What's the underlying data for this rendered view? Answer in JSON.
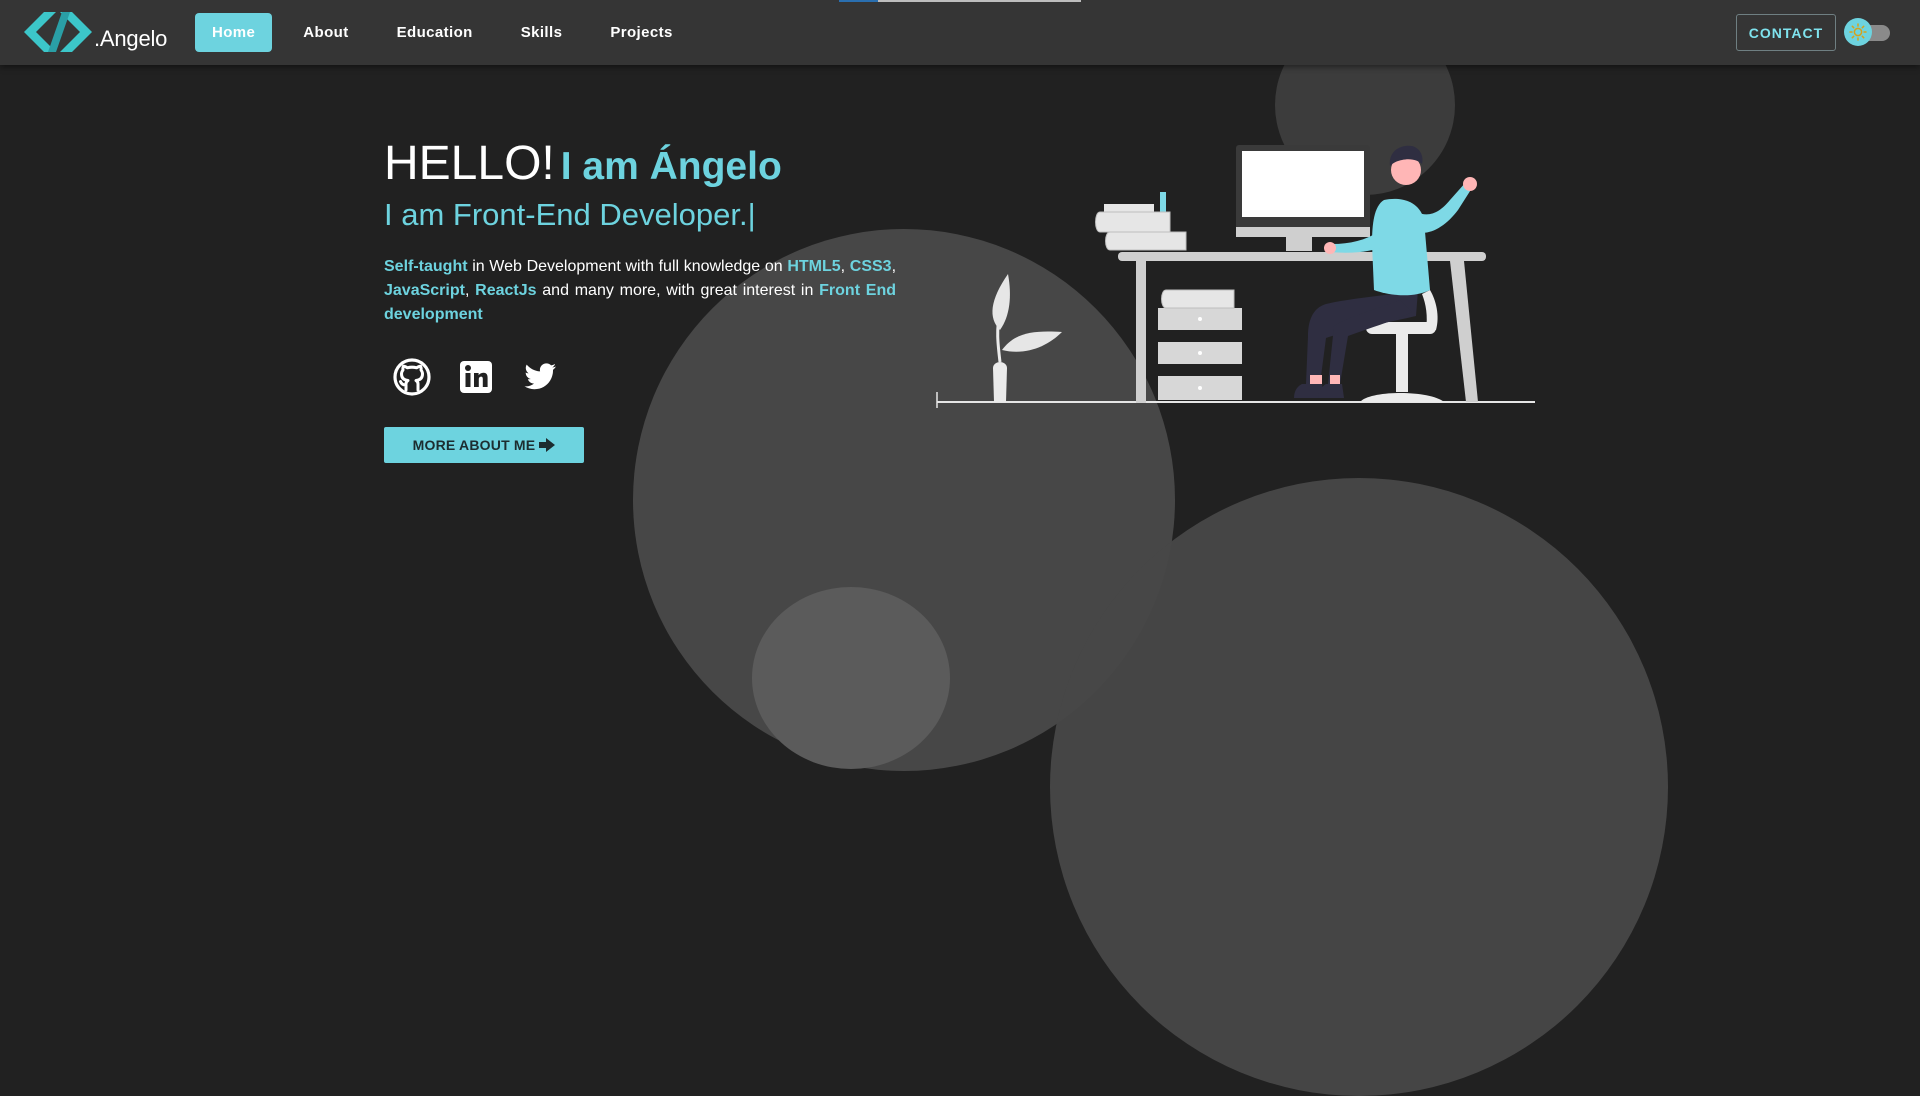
{
  "brand": {
    "name": ".Angelo",
    "logo_icon": "code-brackets-logo"
  },
  "nav": {
    "links": [
      {
        "label": "Home",
        "active": true
      },
      {
        "label": "About",
        "active": false
      },
      {
        "label": "Education",
        "active": false
      },
      {
        "label": "Skills",
        "active": false
      },
      {
        "label": "Projects",
        "active": false
      }
    ],
    "contact_label": "CONTACT",
    "theme_toggle_icon": "sun-icon",
    "scroll_progress": 0.16
  },
  "hero": {
    "hello": "HELLO!",
    "name": "I am Ángelo",
    "subtitle": "I am Front-End Developer.",
    "cursor": "|",
    "bio": {
      "self_taught": "Self-taught",
      "text1": " in Web Development with full knowledge on ",
      "html5": "HTML5",
      "comma1": ", ",
      "css3": "CSS3",
      "comma2": ", ",
      "javascript": "JavaScript",
      "comma3": ", ",
      "reactjs": "ReactJs",
      "text2": " and many more, with great interest in ",
      "frontend": "Front End development"
    },
    "socials": [
      {
        "icon": "github-icon"
      },
      {
        "icon": "linkedin-icon"
      },
      {
        "icon": "twitter-icon"
      }
    ],
    "cta_label": "MORE ABOUT ME",
    "cta_icon": "arrow-right-icon"
  },
  "illustration": {
    "icon": "developer-at-desk-illustration"
  },
  "colors": {
    "background": "#212121",
    "navbar": "#353535",
    "accent": "#6dd3df",
    "text": "#ffffff"
  }
}
